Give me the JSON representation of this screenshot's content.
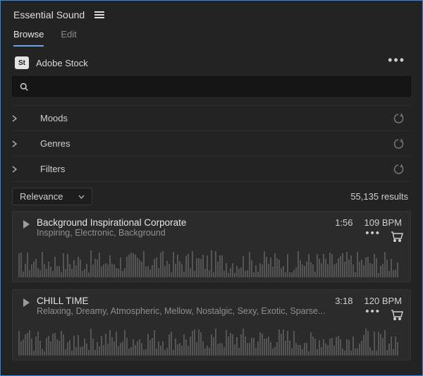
{
  "panel": {
    "title": "Essential Sound"
  },
  "tabs": [
    {
      "label": "Browse",
      "active": true
    },
    {
      "label": "Edit",
      "active": false
    }
  ],
  "stock": {
    "badge": "St",
    "label": "Adobe Stock"
  },
  "search": {
    "value": "",
    "placeholder": ""
  },
  "filters": [
    {
      "label": "Moods"
    },
    {
      "label": "Genres"
    },
    {
      "label": "Filters"
    }
  ],
  "sort": {
    "selected": "Relevance"
  },
  "results": {
    "count_text": "55,135 results"
  },
  "tracks": [
    {
      "title": "Background Inspirational Corporate",
      "tags": "Inspiring, Electronic, Background",
      "duration": "1:56",
      "bpm": "109 BPM"
    },
    {
      "title": "CHILL TIME",
      "tags": "Relaxing, Dreamy, Atmospheric, Mellow, Nostalgic, Sexy, Exotic, Sparse...",
      "duration": "3:18",
      "bpm": "120 BPM"
    }
  ]
}
